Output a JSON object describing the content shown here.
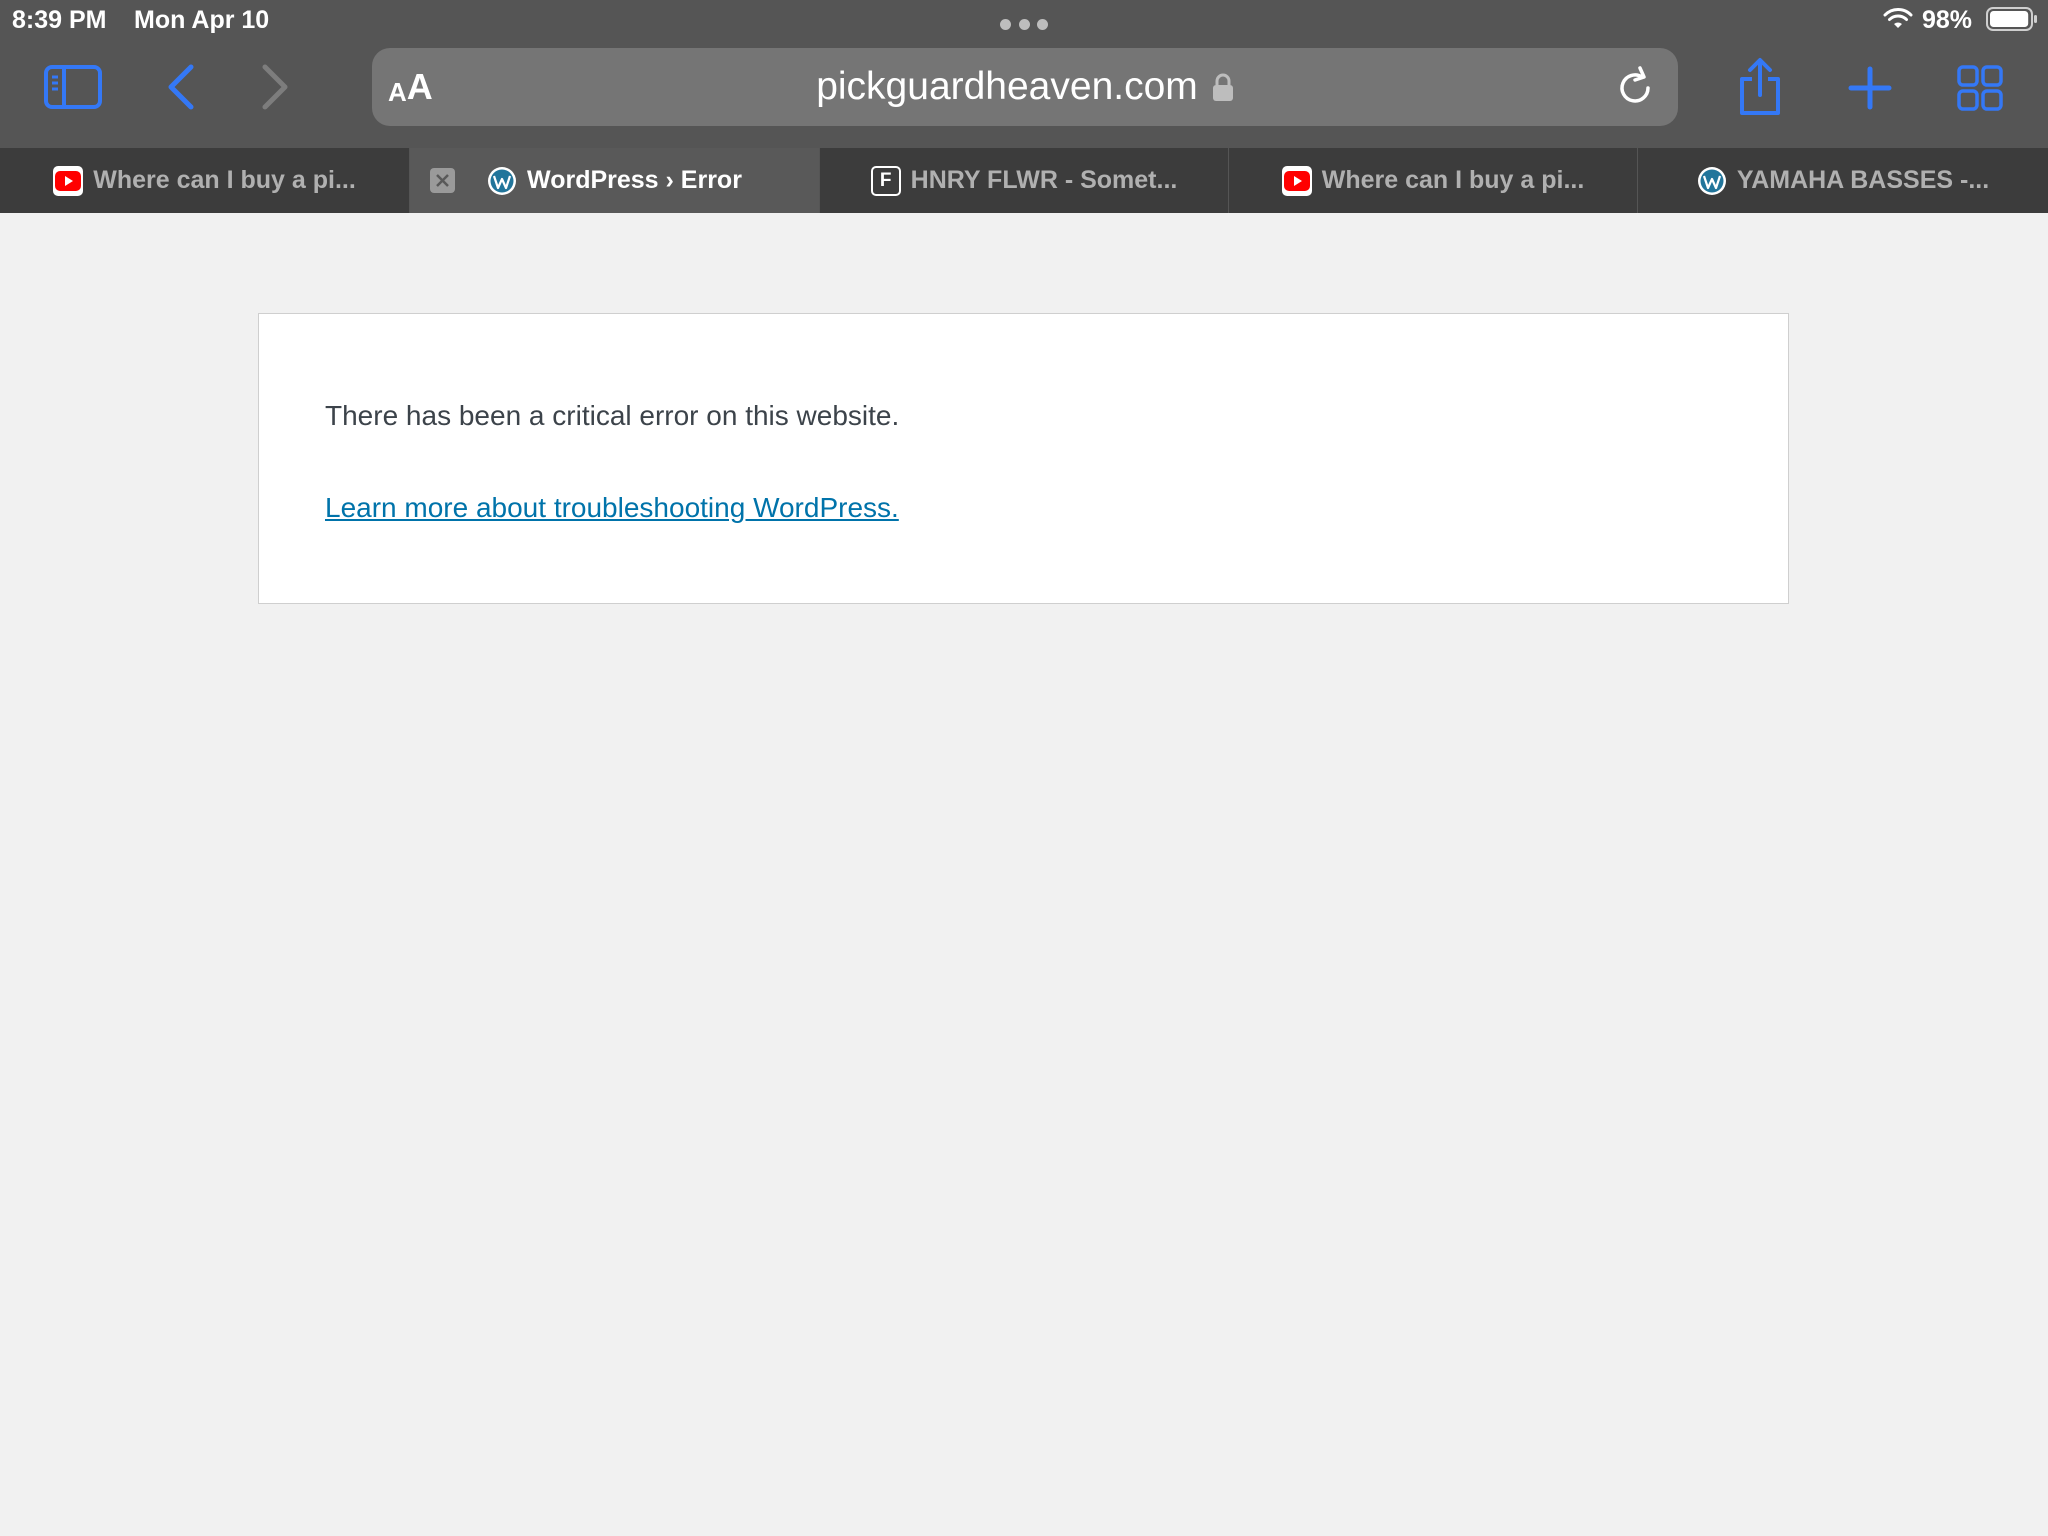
{
  "status_bar": {
    "time": "8:39 PM",
    "date": "Mon Apr 10",
    "battery_percent": "98%",
    "battery_level": 0.98
  },
  "toolbar": {
    "icons": [
      "sidebar-icon",
      "back-icon",
      "forward-icon",
      "share-icon",
      "plus-icon",
      "tab-grid-icon"
    ],
    "accent_color": "#3478f6",
    "disabled_color": "#7d7d7d"
  },
  "address_bar": {
    "reader_small": "A",
    "reader_large": "A",
    "url": "pickguardheaven.com",
    "secure": true
  },
  "tabs": [
    {
      "title": "Where can I buy a pi...",
      "favicon": "youtube-icon",
      "active": false
    },
    {
      "title": "WordPress › Error",
      "favicon": "wordpress-icon",
      "active": true
    },
    {
      "title": "HNRY FLWR - Somet...",
      "favicon": "letter-f-icon",
      "favicon_letter": "F",
      "active": false
    },
    {
      "title": "Where can I buy a pi...",
      "favicon": "youtube-icon",
      "active": false
    },
    {
      "title": "YAMAHA BASSES -...",
      "favicon": "wordpress-icon",
      "active": false
    }
  ],
  "page": {
    "error_message": "There has been a critical error on this website.",
    "link_text": "Learn more about troubleshooting WordPress.",
    "link_color": "#0073aa"
  }
}
